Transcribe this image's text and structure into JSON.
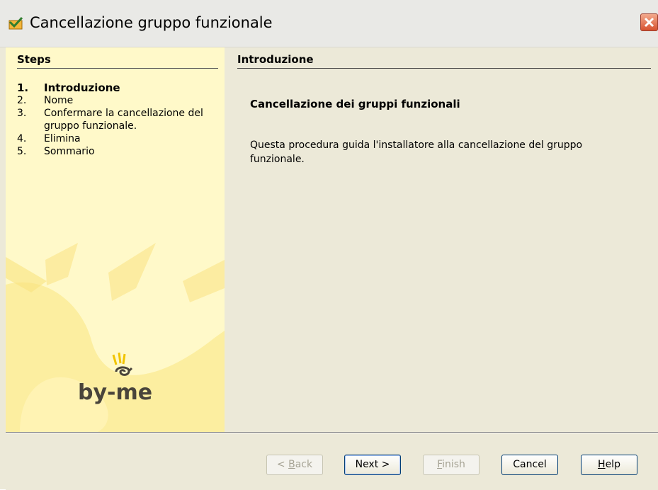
{
  "window": {
    "title": "Cancellazione gruppo funzionale",
    "colors": {
      "left_panel_bg": "#fff9c9",
      "sun_rays": "#fbe68a",
      "brand_text": "#49443b",
      "brand_accent": "#f1c400"
    }
  },
  "steps": {
    "heading": "Steps",
    "items": [
      {
        "num": "1.",
        "label": "Introduzione",
        "active": true
      },
      {
        "num": "2.",
        "label": "Nome"
      },
      {
        "num": "3.",
        "label": "Confermare la cancellazione del gruppo funzionale."
      },
      {
        "num": "4.",
        "label": "Elimina"
      },
      {
        "num": "5.",
        "label": "Sommario"
      }
    ]
  },
  "brand": {
    "name": "by-me"
  },
  "content": {
    "page_title": "Introduzione",
    "section_title": "Cancellazione dei gruppi funzionali",
    "description": "Questa procedura guida l'installatore alla cancellazione del gruppo funzionale."
  },
  "buttons": {
    "back": {
      "prefix": "< ",
      "underlined": "B",
      "rest": "ack",
      "enabled": false
    },
    "next": {
      "label": "Next >",
      "enabled": true
    },
    "finish": {
      "underlined": "F",
      "rest": "inish",
      "enabled": false
    },
    "cancel": {
      "label": "Cancel",
      "enabled": true
    },
    "help": {
      "underlined": "H",
      "rest": "elp",
      "enabled": true
    }
  }
}
